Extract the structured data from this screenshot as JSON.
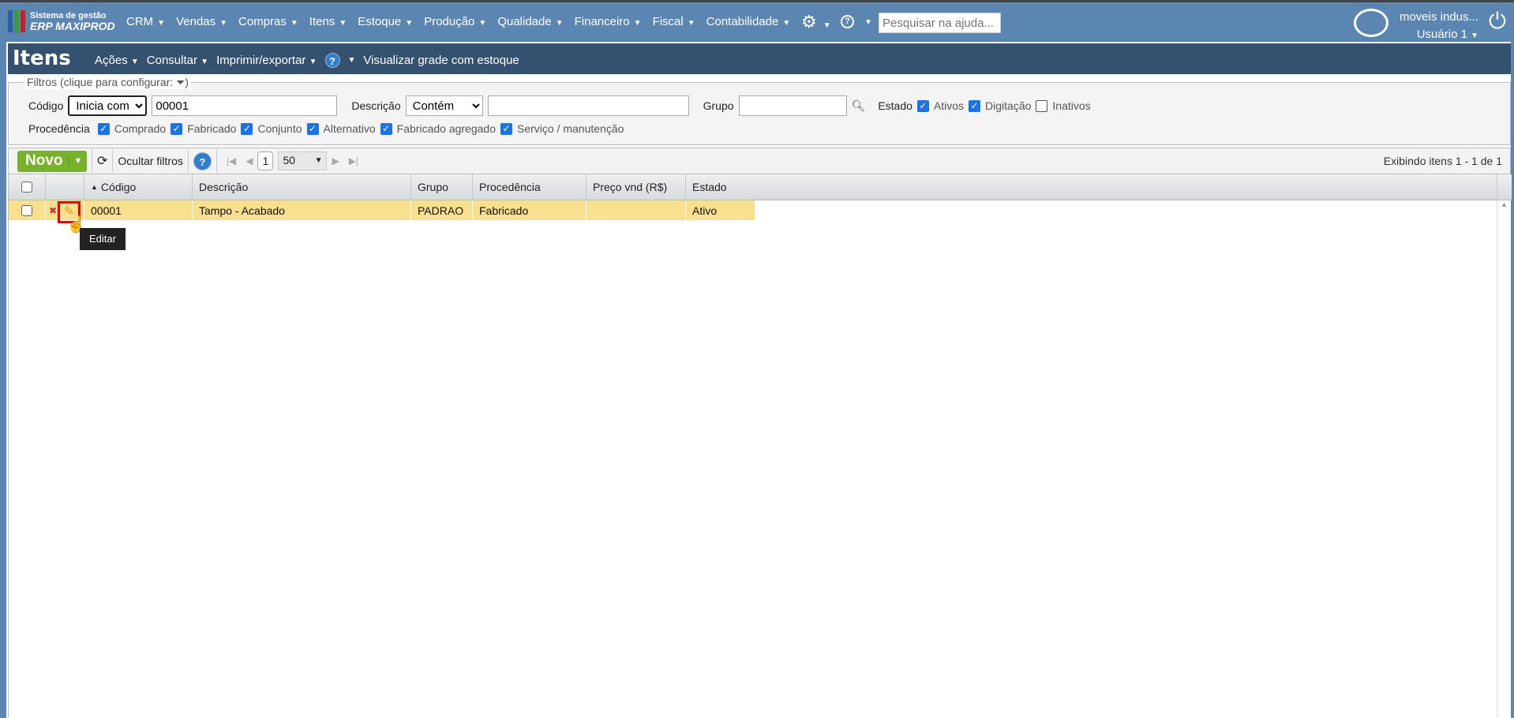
{
  "app": {
    "brand_line1": "Sistema de gestão",
    "brand_line2": "ERP MAXIPROD",
    "menu": [
      "CRM",
      "Vendas",
      "Compras",
      "Itens",
      "Estoque",
      "Produção",
      "Qualidade",
      "Financeiro",
      "Fiscal",
      "Contabilidade"
    ],
    "search_placeholder": "Pesquisar na ajuda...",
    "company": "moveis indus...",
    "user": "Usuário 1"
  },
  "page": {
    "title": "Itens",
    "menu": [
      "Ações",
      "Consultar",
      "Imprimir/exportar"
    ],
    "help": "?",
    "grid_view": "Visualizar grade com estoque"
  },
  "filters": {
    "legend": "Filtros (clique para configurar:",
    "legend_end": ")",
    "codigo_label": "Código",
    "codigo_op": "Inicia com",
    "codigo_value": "00001",
    "descricao_label": "Descrição",
    "descricao_op": "Contém",
    "descricao_value": "",
    "grupo_label": "Grupo",
    "grupo_value": "",
    "estado_label": "Estado",
    "estado": [
      {
        "label": "Ativos",
        "checked": true
      },
      {
        "label": "Digitação",
        "checked": true
      },
      {
        "label": "Inativos",
        "checked": false
      }
    ],
    "procedencia_label": "Procedência",
    "procedencia": [
      {
        "label": "Comprado",
        "checked": true
      },
      {
        "label": "Fabricado",
        "checked": true
      },
      {
        "label": "Conjunto",
        "checked": true
      },
      {
        "label": "Alternativo",
        "checked": true
      },
      {
        "label": "Fabricado agregado",
        "checked": true
      },
      {
        "label": "Serviço / manutenção",
        "checked": true
      }
    ]
  },
  "toolbar": {
    "novo": "Novo",
    "hide_filters": "Ocultar filtros",
    "page": "1",
    "page_size": "50",
    "showing": "Exibindo itens 1 - 1 de 1"
  },
  "grid": {
    "columns": [
      "Código",
      "Descrição",
      "Grupo",
      "Procedência",
      "Preço vnd (R$)",
      "Estado"
    ],
    "rows": [
      {
        "codigo": "00001",
        "descricao": "Tampo - Acabado",
        "grupo": "PADRAO",
        "procedencia": "Fabricado",
        "preco": "",
        "estado": "Ativo"
      }
    ]
  },
  "tooltip": "Editar",
  "colors": {
    "topbar": "#5b86b2",
    "titlebar": "#34516f",
    "novo": "#77b22a",
    "row_highlight": "#f8e08f"
  }
}
